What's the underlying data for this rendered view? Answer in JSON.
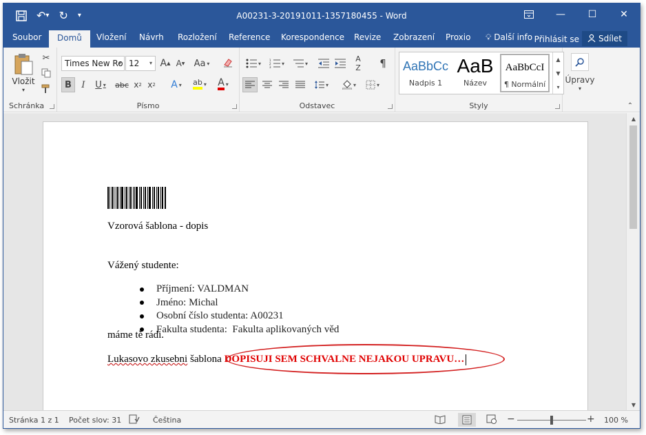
{
  "titlebar": {
    "title": "A00231-3-20191011-1357180455 - Word",
    "qat_icons": [
      "save-icon",
      "undo-icon",
      "redo-icon",
      "customize-qat-icon"
    ]
  },
  "tabs": [
    "Soubor",
    "Domů",
    "Vložení",
    "Návrh",
    "Rozložení",
    "Reference",
    "Korespondence",
    "Revize",
    "Zobrazení",
    "Proxio",
    "Další info"
  ],
  "active_tab": "Domů",
  "signin": "Přihlásit se",
  "share": "Sdílet",
  "ribbon": {
    "clipboard": {
      "paste_label": "Vložit",
      "group_label": "Schránka"
    },
    "font": {
      "font_name": "Times New Ro",
      "font_size": "12",
      "group_label": "Písmo"
    },
    "paragraph": {
      "group_label": "Odstavec"
    },
    "styles": {
      "group_label": "Styly",
      "items": [
        {
          "preview": "AaBbCc",
          "name": "Nadpis 1"
        },
        {
          "preview": "AaB",
          "name": "Název"
        },
        {
          "preview": "AaBbCcI",
          "name": "¶ Normální"
        }
      ]
    },
    "editing": {
      "label": "Úpravy"
    }
  },
  "document": {
    "heading": "Vzorová šablona - dopis",
    "greeting": "Vážený studente:",
    "bullets": [
      "Příjmení: VALDMAN",
      "Jméno: Michal",
      "Osobní číslo studenta: A00231",
      "Fakulta studenta:  Fakulta aplikovaných věd"
    ],
    "closing": "máme tě rádi.",
    "last_line_prefix": "Lukasovo zkusebni",
    "last_line_middle": " šablona ",
    "last_line_highlight": "DOPISUJI SEM SCHVALNE NEJAKOU UPRAVU…"
  },
  "statusbar": {
    "page": "Stránka 1 z 1",
    "words": "Počet slov: 31",
    "language": "Čeština",
    "zoom": "100 %"
  }
}
